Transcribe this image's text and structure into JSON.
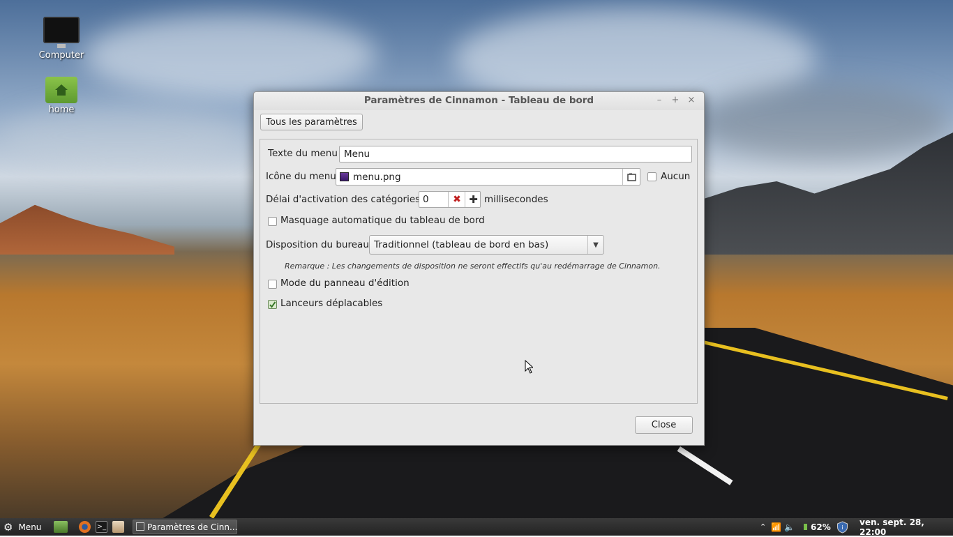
{
  "desktop": {
    "icons": [
      {
        "label": "Computer",
        "icon": "computer-icon"
      },
      {
        "label": "home",
        "icon": "home-folder-icon"
      }
    ]
  },
  "window": {
    "title": "Paramètres de Cinnamon - Tableau de bord",
    "controls": {
      "minimize": "–",
      "maximize": "+",
      "close": "×"
    },
    "all_settings_button": "Tous les paramètres",
    "menu_text": {
      "label": "Texte du menu",
      "value": "Menu"
    },
    "menu_icon": {
      "label": "Icône du menu",
      "value": "menu.png",
      "none_label": "Aucun",
      "none_checked": false
    },
    "delay": {
      "label": "Délai d'activation des catégories",
      "value": "0",
      "unit": "millisecondes"
    },
    "autohide": {
      "label": "Masquage automatique du tableau de bord",
      "checked": false
    },
    "layout": {
      "label": "Disposition du bureau",
      "value": "Traditionnel (tableau de bord en bas)"
    },
    "note": "Remarque : Les changements de disposition ne seront effectifs qu'au redémarrage de Cinnamon.",
    "edit_mode": {
      "label": "Mode du panneau d'édition",
      "checked": false
    },
    "movable_launchers": {
      "label": "Lanceurs déplacables",
      "checked": true
    },
    "close_button": "Close"
  },
  "taskbar": {
    "menu_label": "Menu",
    "launchers": [
      "show-desktop-icon",
      "firefox-icon",
      "terminal-icon",
      "files-icon"
    ],
    "active_window": "Paramètres de Cinn...",
    "battery": "62%",
    "clock": "ven. sept. 28, 22:00"
  },
  "colors": {
    "accent_green": "#6a9a3a",
    "taskbar_bg": "#2b2b2b",
    "window_bg": "#e8e8e8"
  }
}
